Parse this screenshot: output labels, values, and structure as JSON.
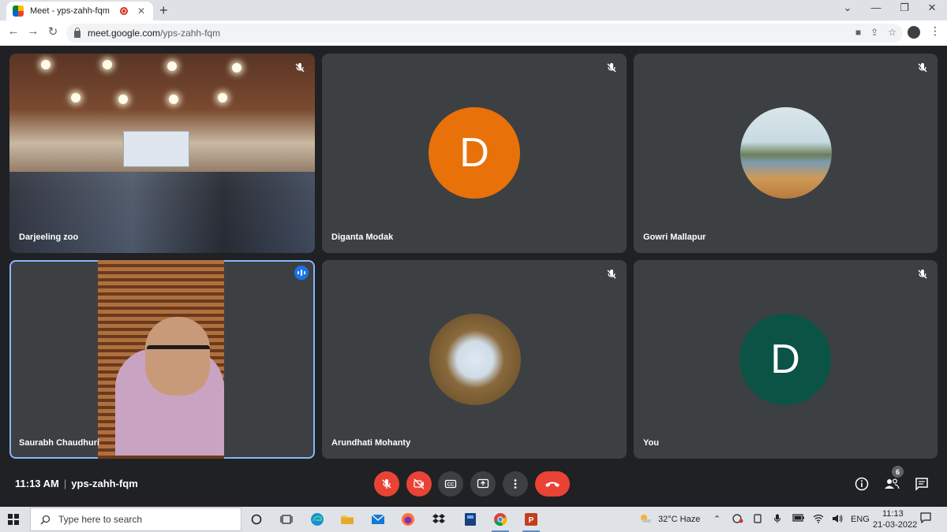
{
  "browser": {
    "tab_title": "Meet - yps-zahh-fqm",
    "url_host": "meet.google.com",
    "url_path": "/yps-zahh-fqm"
  },
  "participants": [
    {
      "name": "Darjeeling zoo",
      "muted": true
    },
    {
      "name": "Diganta Modak",
      "avatar_letter": "D",
      "avatar_color": "#e8710a",
      "muted": true
    },
    {
      "name": "Gowri Mallapur",
      "muted": true
    },
    {
      "name": "Saurabh Chaudhuri",
      "speaking": true
    },
    {
      "name": "Arundhati Mohanty",
      "muted": true
    },
    {
      "name": "You",
      "avatar_letter": "D",
      "avatar_color": "#0b5345",
      "muted": true
    }
  ],
  "meeting": {
    "time": "11:13 AM",
    "code": "yps-zahh-fqm",
    "participant_count": "6"
  },
  "taskbar": {
    "search_placeholder": "Type here to search",
    "weather": "32°C  Haze",
    "language": "ENG",
    "time": "11:13",
    "date": "21-03-2022"
  },
  "colors": {
    "tile_bg": "#3c4043",
    "meet_bg": "#202124",
    "danger": "#ea4335",
    "active_outline": "#8ab4f8"
  }
}
